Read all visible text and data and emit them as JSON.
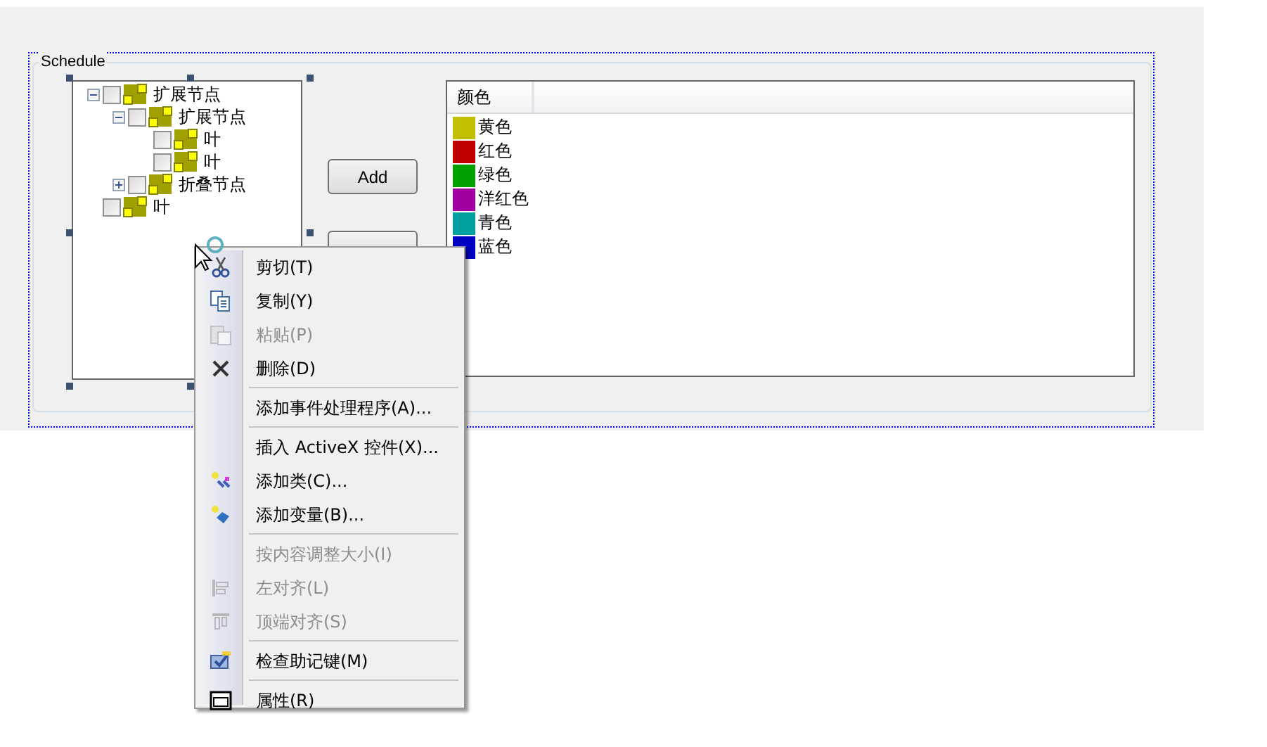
{
  "group": {
    "title": "Schedule"
  },
  "tree": [
    {
      "label": "扩展节点",
      "expanded": true,
      "checked": false,
      "children": [
        {
          "label": "扩展节点",
          "expanded": true,
          "checked": false,
          "children": [
            {
              "label": "叶",
              "checked": false
            },
            {
              "label": "叶",
              "checked": false
            }
          ]
        },
        {
          "label": "折叠节点",
          "expanded": false,
          "checked": false
        }
      ]
    },
    {
      "label": "叶",
      "checked": false
    }
  ],
  "buttons": [
    {
      "label": "Add"
    }
  ],
  "list": {
    "columns": [
      "颜色"
    ],
    "items": [
      {
        "label": "黄色",
        "color": "#c0c000"
      },
      {
        "label": "红色",
        "color": "#c00000"
      },
      {
        "label": "绿色",
        "color": "#00a000"
      },
      {
        "label": "洋红色",
        "color": "#a000a0"
      },
      {
        "label": "青色",
        "color": "#00a0a0"
      },
      {
        "label": "蓝色",
        "color": "#0000c0"
      }
    ]
  },
  "context_menu": [
    {
      "kind": "item",
      "label": "剪切(T)",
      "disabled": false
    },
    {
      "kind": "item",
      "label": "复制(Y)",
      "disabled": false
    },
    {
      "kind": "item",
      "label": "粘贴(P)",
      "disabled": true
    },
    {
      "kind": "item",
      "label": "删除(D)",
      "disabled": false
    },
    {
      "kind": "separator"
    },
    {
      "kind": "item",
      "label": "添加事件处理程序(A)...",
      "disabled": false
    },
    {
      "kind": "separator"
    },
    {
      "kind": "item",
      "label": "插入 ActiveX 控件(X)...",
      "disabled": false
    },
    {
      "kind": "item",
      "label": "添加类(C)...",
      "disabled": false
    },
    {
      "kind": "item",
      "label": "添加变量(B)...",
      "disabled": false
    },
    {
      "kind": "separator"
    },
    {
      "kind": "item",
      "label": "按内容调整大小(I)",
      "disabled": true
    },
    {
      "kind": "item",
      "label": "左对齐(L)",
      "disabled": true
    },
    {
      "kind": "item",
      "label": "顶端对齐(S)",
      "disabled": true
    },
    {
      "kind": "separator"
    },
    {
      "kind": "item",
      "label": "检查助记键(M)",
      "disabled": false
    },
    {
      "kind": "separator"
    },
    {
      "kind": "item",
      "label": "属性(R)",
      "disabled": false
    }
  ]
}
